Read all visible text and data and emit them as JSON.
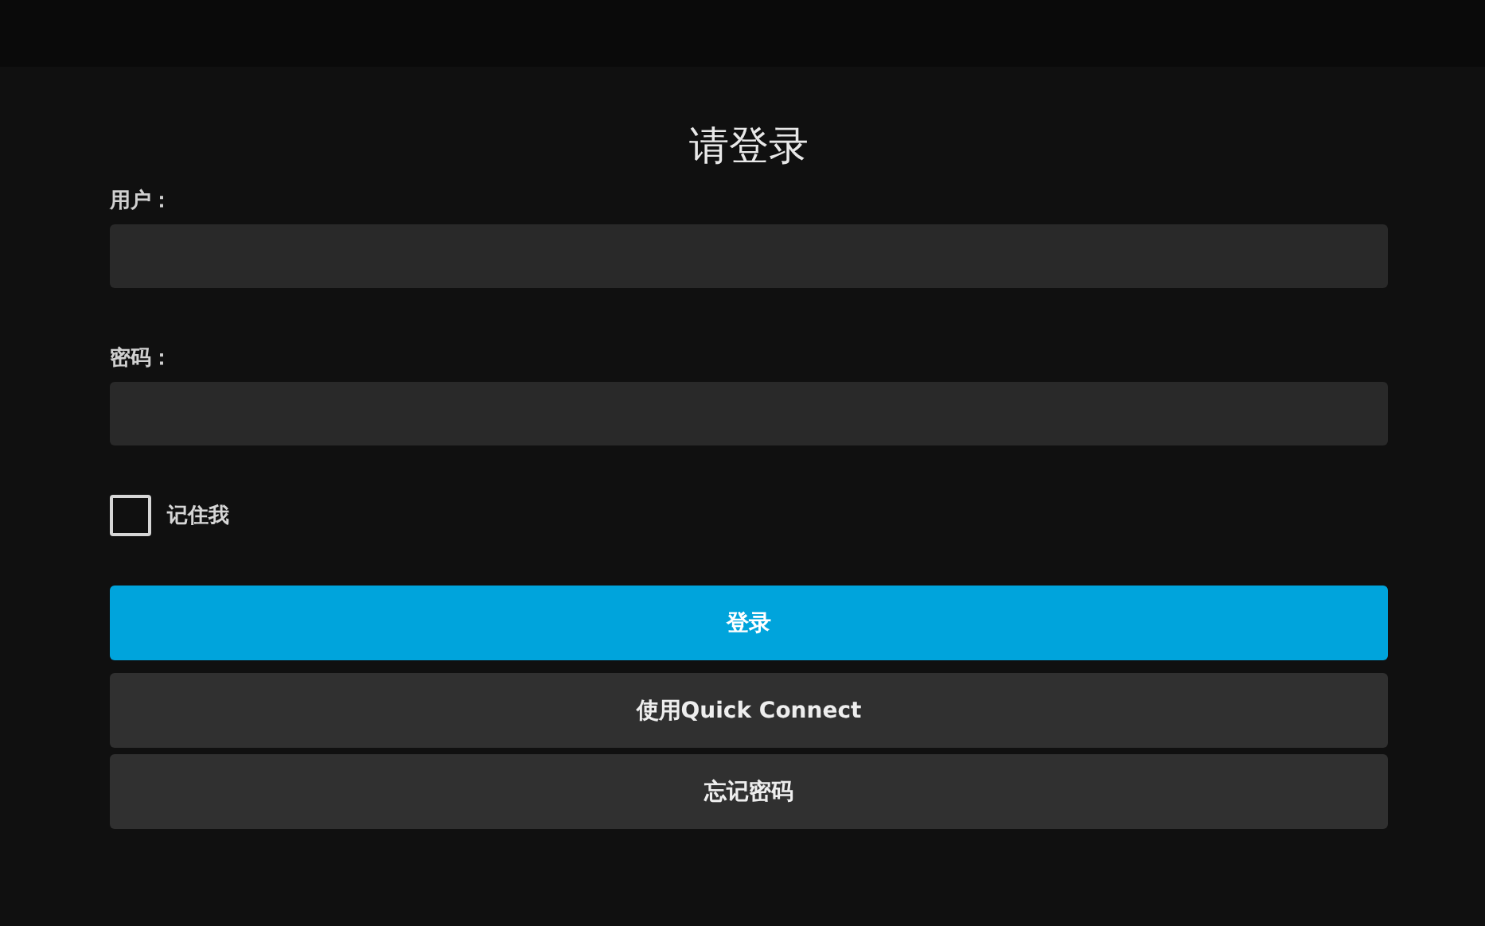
{
  "title": "请登录",
  "fields": [
    {
      "label": "用户："
    },
    {
      "label": "密码："
    }
  ],
  "remember": {
    "label": "记住我",
    "checked": false
  },
  "buttons": [
    {
      "label": "登录",
      "kind": "primary"
    },
    {
      "label": "使用Quick Connect",
      "kind": "secondary"
    },
    {
      "label": "忘记密码",
      "kind": "secondary"
    }
  ]
}
